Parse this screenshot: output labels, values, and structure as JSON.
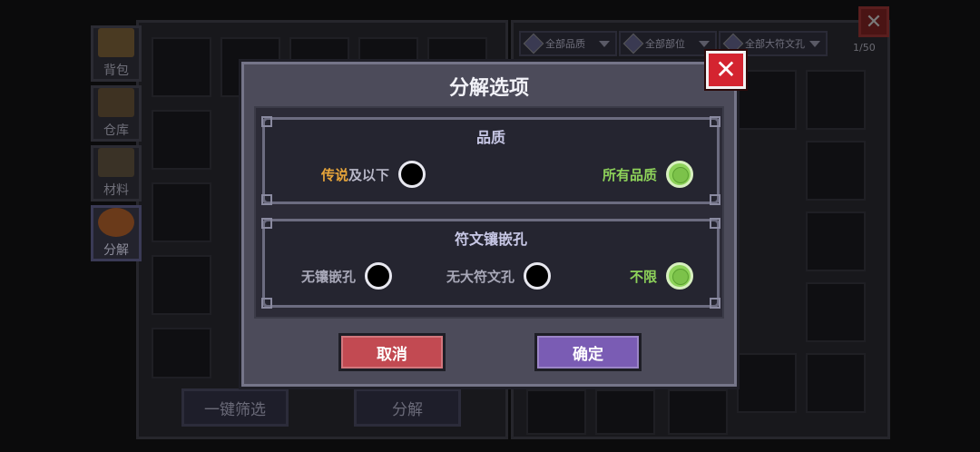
{
  "background": {
    "side_tabs": [
      {
        "label": "背包"
      },
      {
        "label": "仓库"
      },
      {
        "label": "材料"
      },
      {
        "label": "分解"
      }
    ],
    "filters": [
      {
        "label": "全部品质"
      },
      {
        "label": "全部部位"
      },
      {
        "label": "全部大符文孔"
      }
    ],
    "counter": "1/50",
    "bottom_buttons": [
      {
        "label": "一键筛选"
      },
      {
        "label": "分解"
      }
    ]
  },
  "dialog": {
    "title": "分解选项",
    "quality_section": {
      "title": "品质",
      "option_legend_highlight": "传说",
      "option_legend_rest": "及以下",
      "option_all": "所有品质",
      "selected": "所有品质"
    },
    "rune_section": {
      "title": "符文镶嵌孔",
      "option_none": "无镶嵌孔",
      "option_no_big": "无大符文孔",
      "option_unlimited": "不限",
      "selected": "不限"
    },
    "cancel_label": "取消",
    "confirm_label": "确定"
  },
  "colors": {
    "legend_orange": "#e7a53a",
    "selected_green": "#8ed35a",
    "cancel_red": "#c24a52",
    "confirm_purple": "#7a5cb4",
    "close_red": "#d42430"
  }
}
